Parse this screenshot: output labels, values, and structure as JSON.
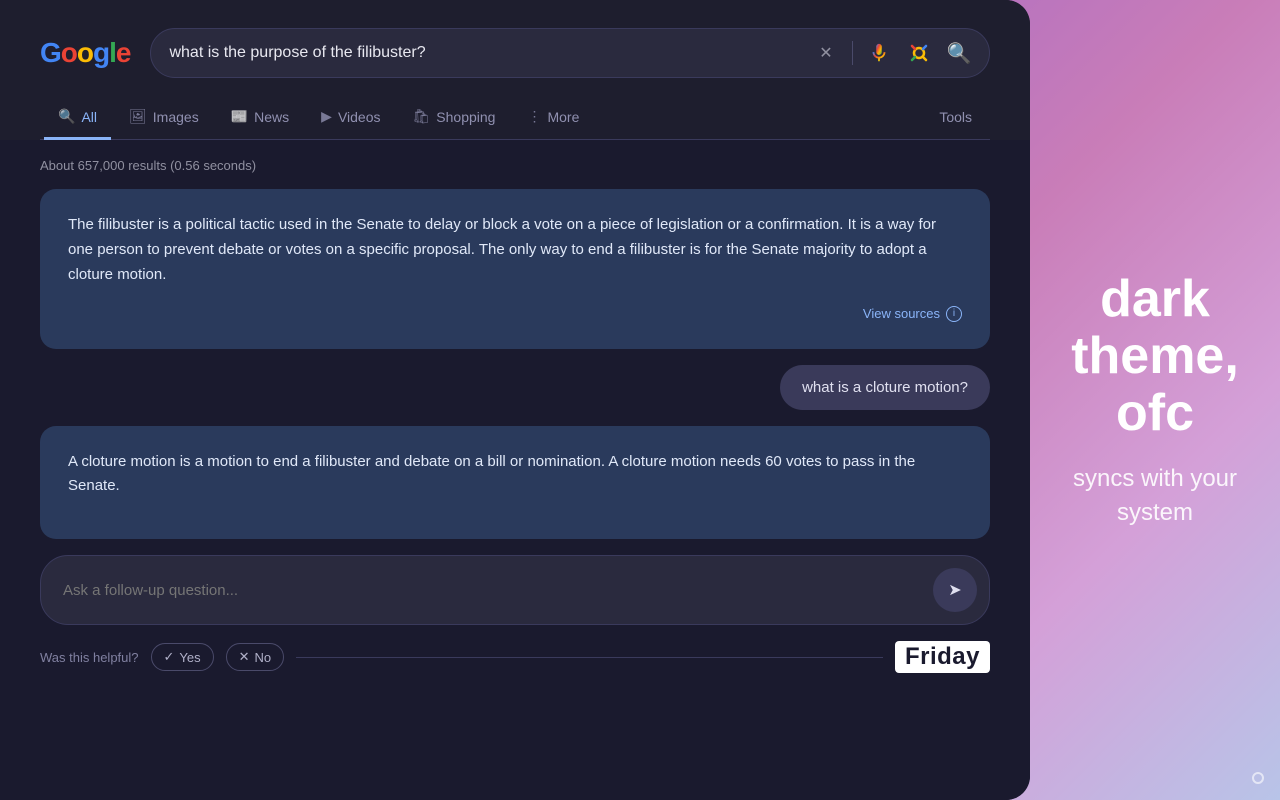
{
  "background": {
    "gradient": "linear-gradient(135deg, #7b5ea7 0%, #a066c8 30%, #c97db8 60%, #b8c4e8 100%)"
  },
  "logo": {
    "text": "ogle"
  },
  "search": {
    "query": "what is the purpose of the filibuster?",
    "placeholder": "Search",
    "clear_label": "✕"
  },
  "nav": {
    "tabs": [
      {
        "id": "all",
        "label": "All",
        "active": true,
        "icon": "🔍"
      },
      {
        "id": "images",
        "label": "Images",
        "active": false,
        "icon": "🖼"
      },
      {
        "id": "news",
        "label": "News",
        "active": false,
        "icon": "📰"
      },
      {
        "id": "videos",
        "label": "Videos",
        "active": false,
        "icon": "▶"
      },
      {
        "id": "shopping",
        "label": "Shopping",
        "active": false,
        "icon": "🛍"
      },
      {
        "id": "more",
        "label": "More",
        "active": false,
        "icon": "⋮"
      }
    ],
    "tools_label": "Tools"
  },
  "results": {
    "count_text": "About 657,000 results (0.56 seconds)"
  },
  "ai_answer_1": {
    "text": "The filibuster is a political tactic used in the Senate to delay or block a vote on a piece of legislation or a confirmation. It is a way for one person to prevent debate or votes on a specific proposal. The only way to end a filibuster is for the Senate majority to adopt a cloture motion.",
    "view_sources_label": "View sources"
  },
  "user_question": {
    "text": "what is a cloture motion?"
  },
  "ai_answer_2": {
    "text": "A cloture motion is a motion to end a filibuster and debate on a bill or nomination. A cloture motion needs 60 votes to pass in the Senate."
  },
  "followup": {
    "placeholder": "Ask a follow-up question...",
    "send_icon": "➤"
  },
  "helpful": {
    "label": "Was this helpful?",
    "yes_label": "Yes",
    "no_label": "No",
    "yes_icon": "✓",
    "no_icon": "✕"
  },
  "promo": {
    "title_line1": "dark",
    "title_line2": "theme,",
    "title_line3": "ofc",
    "subtitle": "syncs with your system"
  },
  "friday": {
    "brand": "Friday"
  }
}
